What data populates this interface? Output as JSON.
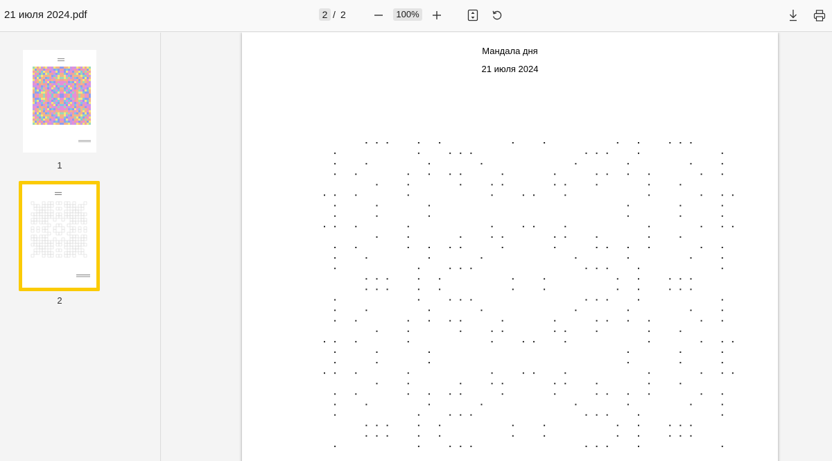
{
  "toolbar": {
    "file_name": "21 июля 2024.pdf",
    "current_page": "2",
    "separator": "/",
    "total_pages": "2",
    "zoom": "100%",
    "zoom_out_icon": "minus-icon",
    "zoom_in_icon": "plus-icon",
    "fit_icon": "fit-page-icon",
    "rotate_icon": "rotate-icon",
    "download_icon": "download-icon",
    "print_icon": "print-icon"
  },
  "sidebar": {
    "thumbnails": [
      {
        "label": "1"
      },
      {
        "label": "2"
      }
    ],
    "selected_border_color": "#fbcb05"
  },
  "page": {
    "title": "Мандала дня",
    "date": "21 июля 2024"
  },
  "colors": {
    "toolbar_bg": "#f9f9f9",
    "sidebar_bg": "#f4f4f4",
    "dot": "#222222"
  }
}
